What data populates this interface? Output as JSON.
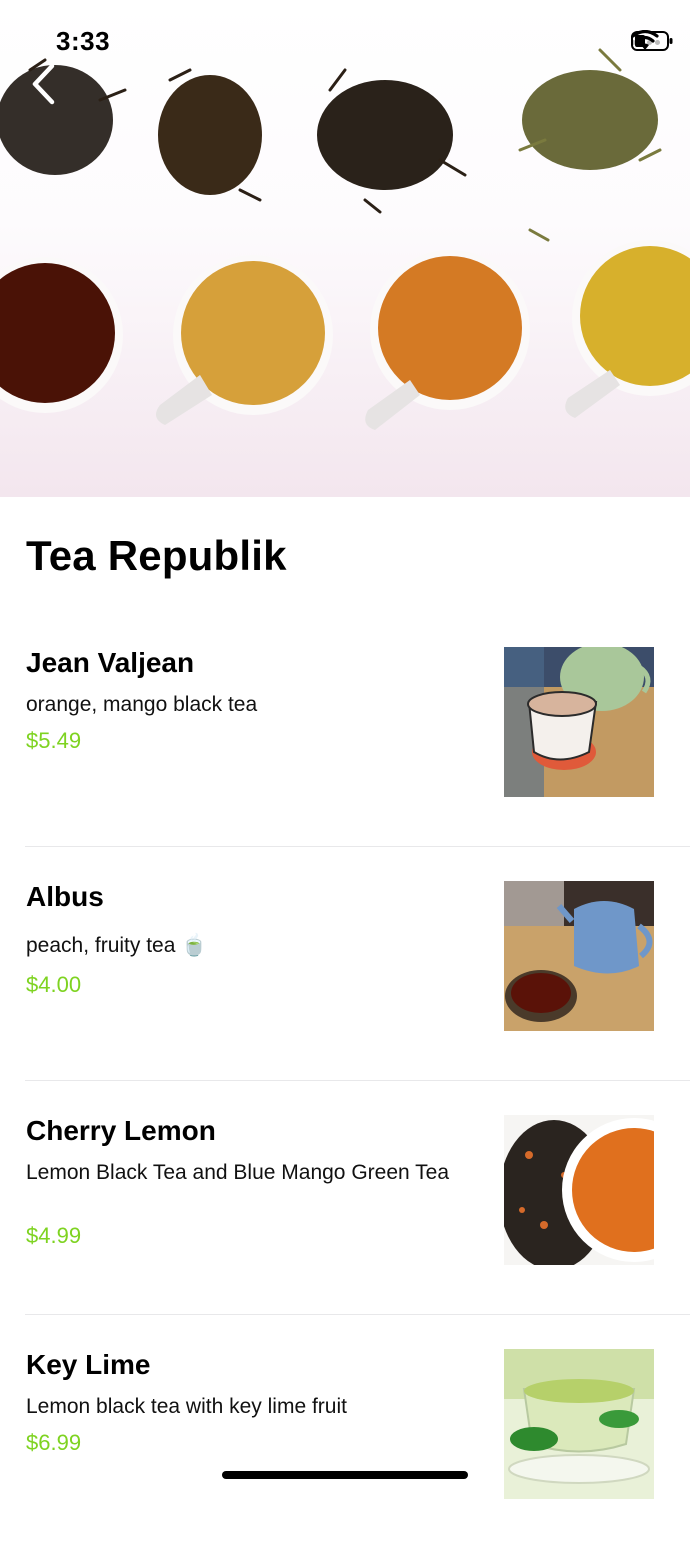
{
  "status_bar": {
    "time": "3:33"
  },
  "restaurant": {
    "name": "Tea Republik"
  },
  "menu_items": [
    {
      "name": "Jean Valjean",
      "description": "orange, mango black tea",
      "price": "$5.49",
      "thumb_icon": "teacup-photo"
    },
    {
      "name": "Albus",
      "description": "peach, fruity tea 🍵",
      "price": "$4.00",
      "thumb_icon": "blue-teapot-photo"
    },
    {
      "name": "Cherry Lemon",
      "description": "Lemon Black Tea and Blue Mango Green Tea",
      "price": "$4.99",
      "thumb_icon": "loose-leaf-tea-photo"
    },
    {
      "name": "Key Lime",
      "description": "Lemon black tea with key lime fruit",
      "price": "$6.99",
      "thumb_icon": "green-tea-cups-photo"
    }
  ],
  "colors": {
    "price": "#7ed321",
    "divider": "#e8e8ea"
  }
}
